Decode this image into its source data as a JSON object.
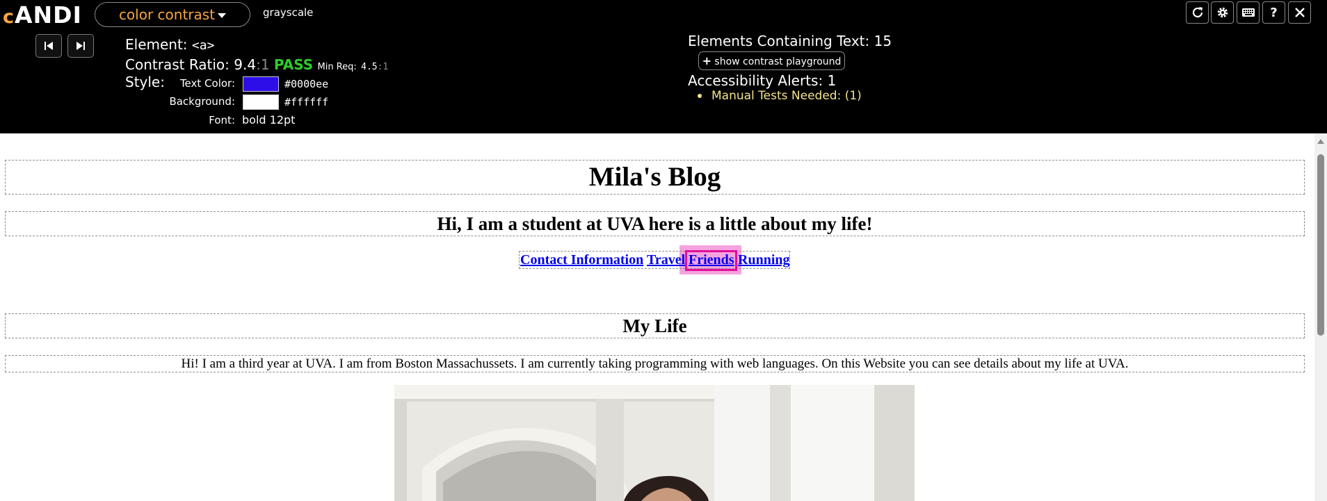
{
  "andi": {
    "logo_c": "c",
    "logo_rest": "ANDI",
    "mode": "color contrast",
    "grayscale": "grayscale",
    "element_label": "Element:",
    "element_value": "<a>",
    "contrast_label": "Contrast Ratio:",
    "contrast_value": "9.4",
    "contrast_sep": ":1",
    "pass": "PASS",
    "min_req_label": "Min Req:",
    "min_req_value": "4.5",
    "min_req_sep": ":1",
    "style_label": "Style:",
    "text_color_label": "Text Color:",
    "text_color_hex": "#0000ee",
    "text_color_swatch": "#2e0ee8",
    "background_label": "Background:",
    "background_hex": "#ffffff",
    "background_swatch": "#ffffff",
    "font_label": "Font:",
    "font_value": "bold 12pt",
    "elements_text_label": "Elements Containing Text:",
    "elements_text_count": "15",
    "playground_button": "show contrast playground",
    "alerts_label": "Accessibility Alerts:",
    "alerts_count": "1",
    "alert_item": "Manual Tests Needed: (1)",
    "tool_buttons": [
      "refresh-icon",
      "gear-icon",
      "keyboard-icon",
      "help-icon",
      "close-icon"
    ],
    "help_glyph": "?"
  },
  "page": {
    "title": "Mila's Blog",
    "subtitle": "Hi, I am a student at UVA here is a little about my life!",
    "nav_links": [
      "Contact Information",
      "Travel",
      "Friends",
      "Running"
    ],
    "section_heading": "My Life",
    "intro": "Hi! I am a third year at UVA. I am from Boston Massachussets. I am currently taking programming with web languages. On this Website you can see details about my life at UVA."
  },
  "colors": {
    "toolbar_bg": "#000000",
    "accent_orange": "#f7a440",
    "pass_green": "#2ecc2e",
    "alert_yellow": "#f2e38a",
    "link_blue": "#0000ee",
    "highlight_pink": "#e0109a"
  }
}
